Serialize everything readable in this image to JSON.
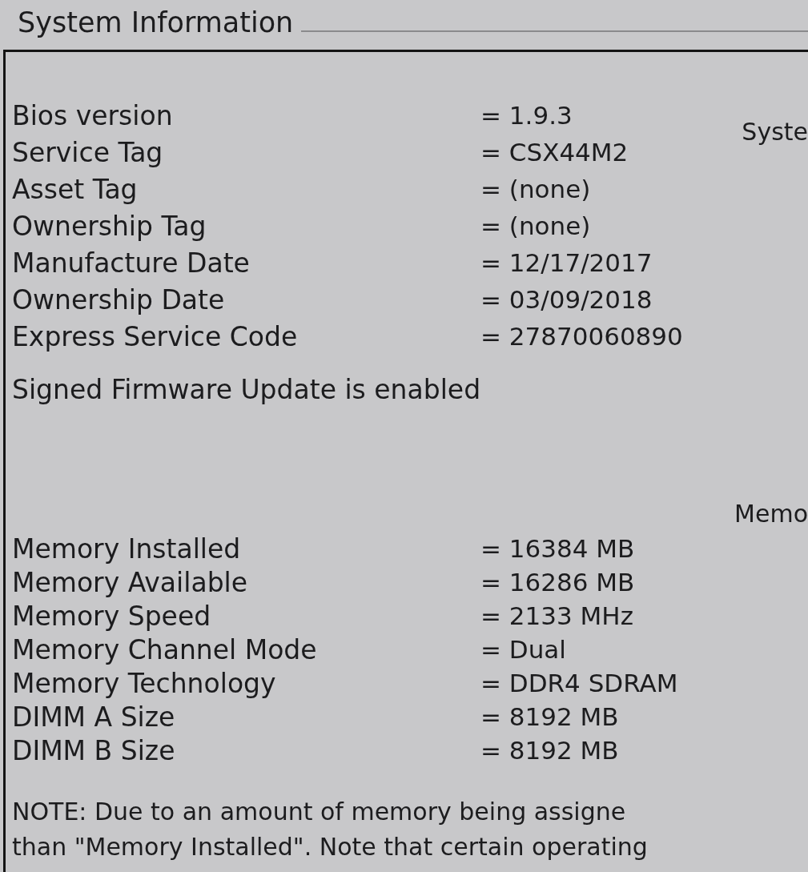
{
  "group_title": "System Information",
  "system": {
    "side_heading": "Syste",
    "rows": [
      {
        "label": "Bios version",
        "value": "= 1.9.3"
      },
      {
        "label": "Service Tag",
        "value": "= CSX44M2"
      },
      {
        "label": "Asset Tag",
        "value": "= (none)"
      },
      {
        "label": "Ownership Tag",
        "value": "= (none)"
      },
      {
        "label": "Manufacture Date",
        "value": "= 12/17/2017"
      },
      {
        "label": "Ownership Date",
        "value": "= 03/09/2018"
      },
      {
        "label": "Express Service Code",
        "value": "= 27870060890"
      }
    ]
  },
  "firmware_status": "Signed Firmware Update is enabled",
  "memory": {
    "side_heading": "Memo",
    "rows": [
      {
        "label": "Memory Installed",
        "value": "= 16384 MB"
      },
      {
        "label": "Memory Available",
        "value": "= 16286 MB"
      },
      {
        "label": "Memory Speed",
        "value": "= 2133 MHz"
      },
      {
        "label": "Memory Channel Mode",
        "value": "= Dual"
      },
      {
        "label": "Memory Technology",
        "value": "= DDR4 SDRAM"
      },
      {
        "label": "DIMM A Size",
        "value": "= 8192 MB"
      },
      {
        "label": "DIMM B Size",
        "value": "= 8192 MB"
      }
    ]
  },
  "note": [
    "NOTE: Due to an amount of memory being assigne",
    "than \"Memory Installed\". Note that certain operating"
  ]
}
